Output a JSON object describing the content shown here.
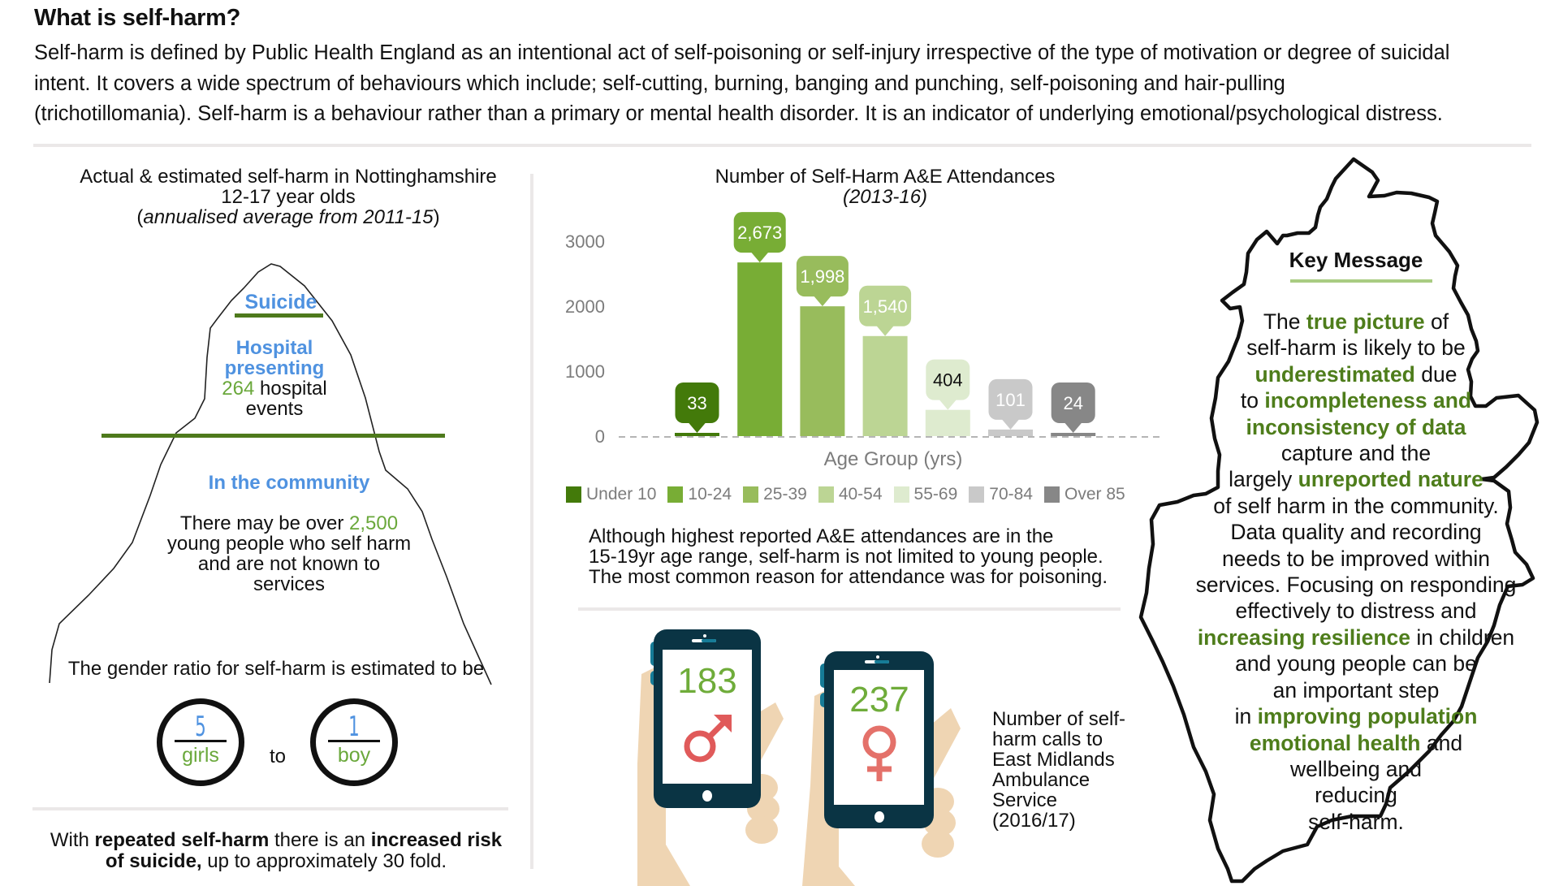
{
  "page": {
    "title": "What is self-harm?",
    "intro_lines": [
      "Self-harm is defined by Public Health England as an intentional act of self-poisoning or self-injury irrespective of the type of motivation or degree of suicidal",
      "intent. It covers a wide spectrum of behaviours which include; self-cutting, burning, banging and punching, self-poisoning and hair-pulling",
      "(trichotillomania). Self-harm is a behaviour rather than a primary or mental health disorder. It is an indicator of underlying emotional/psychological distress."
    ]
  },
  "iceberg": {
    "title_line1": "Actual & estimated self-harm in Nottinghamshire",
    "title_line2": "12-17 year olds",
    "title_line3_pre": "(",
    "title_line3_italic": "annualised average from 2011-15",
    "title_line3_post": ")",
    "suicide_label": "Suicide",
    "hospital_label_1": "Hospital",
    "hospital_label_2": "presenting",
    "hospital_count": "264",
    "hospital_suffix": " hospital",
    "hospital_line4": "events",
    "community_label": "In the community",
    "community_pre": "There may be over ",
    "community_count": "2,500",
    "community_line2": "young people who self harm",
    "community_line3": "and are not known to",
    "community_line4": "services"
  },
  "gender_ratio": {
    "intro": "The gender ratio for self-harm is estimated to be",
    "girls_count": "5",
    "girls_label": "girls",
    "connector": "to",
    "boys_count": "1",
    "boys_label": "boy"
  },
  "risk": {
    "p1": "With ",
    "b1": "repeated self-harm",
    "p2": " there is an ",
    "b2": "increased risk",
    "b3": "of suicide,",
    "p3": " up to approximately 30 fold."
  },
  "chart_data": {
    "type": "bar",
    "title": "Number of Self-Harm A&E Attendances",
    "subtitle": "(2013-16)",
    "xlabel": "Age Group (yrs)",
    "ylabel": "",
    "ylim": [
      0,
      3000
    ],
    "yticks": [
      0,
      1000,
      2000,
      3000
    ],
    "grid": false,
    "legend_position": "bottom",
    "categories": [
      "Under 10",
      "10-24",
      "25-39",
      "40-54",
      "55-69",
      "70-84",
      "Over 85"
    ],
    "values": [
      33,
      2673,
      1998,
      1540,
      404,
      101,
      24
    ],
    "data_labels": [
      "33",
      "2,673",
      "1,998",
      "1,540",
      "404",
      "101",
      "24"
    ],
    "colors": [
      "#437a0a",
      "#78ad35",
      "#98bc5c",
      "#bcd594",
      "#deebcf",
      "#c9c9c9",
      "#878787"
    ],
    "label_text_colors": [
      "#ffffff",
      "#ffffff",
      "#ffffff",
      "#ffffff",
      "#111111",
      "#ffffff",
      "#ffffff"
    ]
  },
  "chart_note": [
    "Although highest reported A&E attendances are in the",
    "15-19yr age range, self-harm is not limited to young people.",
    "The most common reason for attendance was for poisoning."
  ],
  "ambulance": {
    "male_calls": "183",
    "female_calls": "237",
    "male_icon": "male-symbol",
    "female_icon": "female-symbol",
    "caption": [
      "Number of self-",
      "harm calls to",
      "East Midlands",
      "Ambulance",
      "Service",
      "(2016/17)"
    ]
  },
  "key_message": {
    "title": "Key Message",
    "lines": [
      [
        {
          "t": "The "
        },
        {
          "t": "true picture",
          "hl": true
        },
        {
          "t": " of"
        }
      ],
      [
        {
          "t": "self-harm is likely to be"
        }
      ],
      [
        {
          "t": "underestimated",
          "hl": true
        },
        {
          "t": " due"
        }
      ],
      [
        {
          "t": "to "
        },
        {
          "t": "incompleteness and",
          "hl": true
        }
      ],
      [
        {
          "t": "inconsistency of data",
          "hl": true
        }
      ],
      [
        {
          "t": "capture and the"
        }
      ],
      [
        {
          "t": "largely "
        },
        {
          "t": "unreported nature",
          "hl": true
        }
      ],
      [
        {
          "t": "of self harm in the community."
        }
      ],
      [
        {
          "t": "Data quality and recording"
        }
      ],
      [
        {
          "t": "needs to be improved within"
        }
      ],
      [
        {
          "t": "services. Focusing on responding"
        }
      ],
      [
        {
          "t": "effectively to distress and"
        }
      ],
      [
        {
          "t": "increasing resilience",
          "hl": true
        },
        {
          "t": " in children"
        }
      ],
      [
        {
          "t": "and young people can be"
        }
      ],
      [
        {
          "t": "an important step"
        }
      ],
      [
        {
          "t": "in "
        },
        {
          "t": "improving population",
          "hl": true
        }
      ],
      [
        {
          "t": "emotional health",
          "hl": true
        },
        {
          "t": " and"
        }
      ],
      [
        {
          "t": "wellbeing  and"
        }
      ],
      [
        {
          "t": "reducing"
        }
      ],
      [
        {
          "t": "self-harm."
        }
      ]
    ]
  },
  "colors": {
    "accent_green": "#6aa83b",
    "dark_green": "#4e7d1b",
    "label_blue": "#4f92e0",
    "divider": "#ebe8e8",
    "phone_body": "#0a3444",
    "phone_button": "#167c97",
    "hand": "#efd5b3",
    "symbol_red": "#e05a5a"
  }
}
